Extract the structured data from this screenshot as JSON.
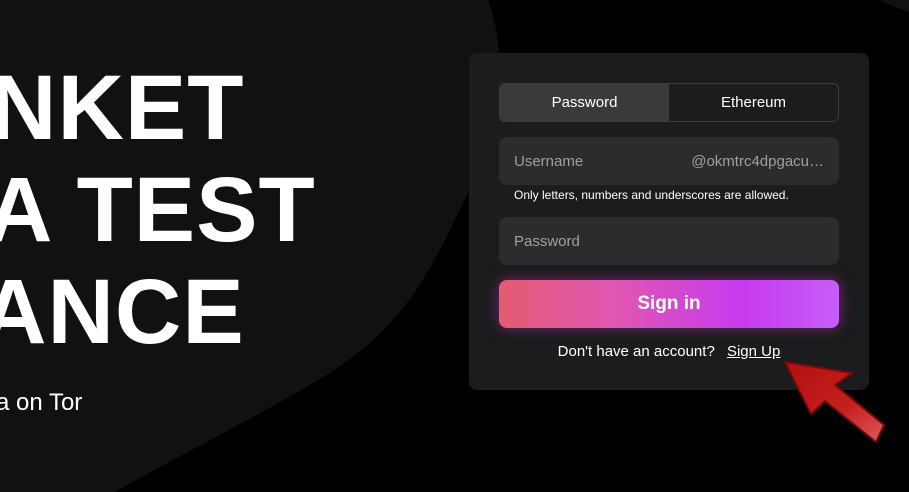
{
  "hero": {
    "line1": "NKET",
    "line2": "A TEST",
    "line3": "ANCE",
    "subtitle": "ra on Tor"
  },
  "auth": {
    "tabs": [
      {
        "label": "Password",
        "active": true
      },
      {
        "label": "Ethereum",
        "active": false
      }
    ],
    "username": {
      "label": "Username",
      "value": "@okmtrc4dpgacu…"
    },
    "username_hint": "Only letters, numbers and underscores are allowed.",
    "password": {
      "label": "Password"
    },
    "signin_label": "Sign in",
    "signup_prompt": "Don't have an account?",
    "signup_link": "Sign Up"
  },
  "colors": {
    "background": "#000000",
    "card": "#1c1b1d",
    "field": "#2c2b2e",
    "button_gradient_start": "#e45b72",
    "button_gradient_end": "#c65ef7",
    "annotation_arrow": "#c01d1d"
  },
  "icons": {
    "annotation": "red-arrow-pointer"
  }
}
